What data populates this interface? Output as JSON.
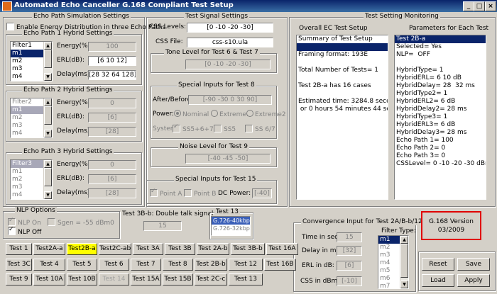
{
  "window": {
    "title": "Automated  Echo Canceller G.168 Compliant Test Setup"
  },
  "echo_sim": {
    "title": "Echo Path Simulation Settings",
    "energy_distribution_label": "Enable Energy Distribution in three Echo Paths",
    "paths": [
      {
        "title": "Echo Path 1 Hybrid Settings",
        "filters": [
          "Filter1",
          "m1",
          "m2",
          "m3",
          "m4"
        ],
        "selected": 1,
        "energy_label": "Energy(%):",
        "energy": "100",
        "erl_label": "ERL(dB):",
        "erl": "[6 10 12]",
        "delay_label": "Delay(ms):",
        "delay": "[28 32 64 128]"
      },
      {
        "title": "Echo Path 2 Hybrid Settings",
        "filters": [
          "Filter2",
          "m1",
          "m2",
          "m3",
          "m4"
        ],
        "selected": 1,
        "energy_label": "Energy(%):",
        "energy": "0",
        "erl_label": "ERL(dB):",
        "erl": "[6]",
        "delay_label": "Delay(ms):",
        "delay": "[28]"
      },
      {
        "title": "Echo Path 3 Hybrid Settings",
        "filters": [
          "Filter3",
          "m1",
          "m2",
          "m3",
          "m4"
        ],
        "selected": 0,
        "energy_label": "Energy(%):",
        "energy": "0",
        "erl_label": "ERL(dB):",
        "erl": "[6]",
        "delay_label": "Delay(ms):",
        "delay": "[28]"
      }
    ]
  },
  "test_signal": {
    "title": "Test Signal Settings",
    "css_levels_label": "CSS Levels:",
    "css_levels": "[0 -10 -20 -30]",
    "css_file_label": "CSS File:",
    "css_file": "css-s10.ula",
    "tone_title": "Tone Level for Test 6 & Test 7",
    "tone": "[0 -10 -20 -30]",
    "special8_title": "Special Inputs for Test 8",
    "after_before_label": "After/Before:",
    "after_before": "[-90 -30 0 30 90]",
    "power_label": "Power:",
    "power_options": [
      "Nominal",
      "Extreme1",
      "Extreme2"
    ],
    "power_selected": 0,
    "system_label": "System:",
    "system_options": [
      "SS5+6+7",
      "SS5",
      "SS 6/7"
    ],
    "noise_title": "Noise Level for Test 9",
    "noise": "[-40 -45 -50]",
    "special15_title": "Special Inputs for Test 15",
    "point_a": "Point A",
    "point_b": "Point B",
    "dc_power_label": "DC Power:",
    "dc_power": "[-40]"
  },
  "monitoring": {
    "title": "Test Setting Monitoring",
    "overall_title": "Overall EC Test Setup",
    "overall_lines": [
      "Summary of Test Setup",
      "",
      "Framing format: 193E",
      "",
      "Total Number of Tests= 1",
      "",
      "Test 2B-a has 16 cases",
      "",
      "Estimated time: 3284.8 seconds",
      " or 0 hours 54 minutes 44 seconds"
    ],
    "params_title": "Parameters for Each Test",
    "params_lines": [
      "Test 2B-a",
      "Selected= Yes",
      "NLP=  OFF",
      "",
      "HybridType= 1",
      "HybridERL= 6 10 dB",
      "HybridDelay= 28  32 ms",
      "HybridType2= 1",
      "HybridERL2= 6 dB",
      "HybridDelay2= 28 ms",
      "HybridType3= 1",
      "HybridERL3= 6 dB",
      "HybridDelay3= 28 ms",
      "Echo Path 1= 100",
      "Echo Path 2= 0",
      "Echo Path 3= 0",
      "CSSLevel= 0 -10 -20 -30 dBm0"
    ]
  },
  "nlp": {
    "title": "NLP Options",
    "nlp_on": "NLP On",
    "nlp_off": "NLP Off",
    "sgen": "Sgen = -55 dBm0"
  },
  "test3b": {
    "title": "Test 3B-b: Double talk signal",
    "value": "15"
  },
  "test13": {
    "title": "Test 13",
    "options": [
      "G.726-40kbps",
      "G.726-32kbps"
    ],
    "selected": 0
  },
  "convergence": {
    "title": "Convergence Input for Test 2A/B-b/12",
    "time_label": "Time in sec.",
    "time": "15",
    "delay_label": "Delay in ms:",
    "delay": "[32]",
    "erl_label": "ERL in dB:",
    "erl": "[6]",
    "css_label": "CSS in dBm0:",
    "css": "[-10]",
    "filter_type_label": "Filter Type:",
    "filters": [
      "m1",
      "m2",
      "m3",
      "m4",
      "m5",
      "m6",
      "m7"
    ],
    "selected": 0
  },
  "version": {
    "line1": "G.168 Version",
    "line2": "03/2009"
  },
  "tests": [
    [
      "Test 1",
      "Test2A-a",
      "Test2B-a",
      "Test2C-ab",
      "Test 3A",
      "Test 3B",
      "Test 2A-b",
      "Test 3B-b",
      "Test 16A"
    ],
    [
      "Test 3C",
      "Test 4",
      "Test 5",
      "Test 6",
      "Test 7",
      "Test 8",
      "Test 2B-b",
      "Test 12",
      "Test 16B"
    ],
    [
      "Test 9",
      "Test 10A",
      "Test 10B",
      "Test 14",
      "Test 15A",
      "Test 15B",
      "Test 2C-c",
      "Test 13"
    ]
  ],
  "actions": {
    "reset": "Reset",
    "save": "Save",
    "load": "Load",
    "apply": "Apply"
  }
}
